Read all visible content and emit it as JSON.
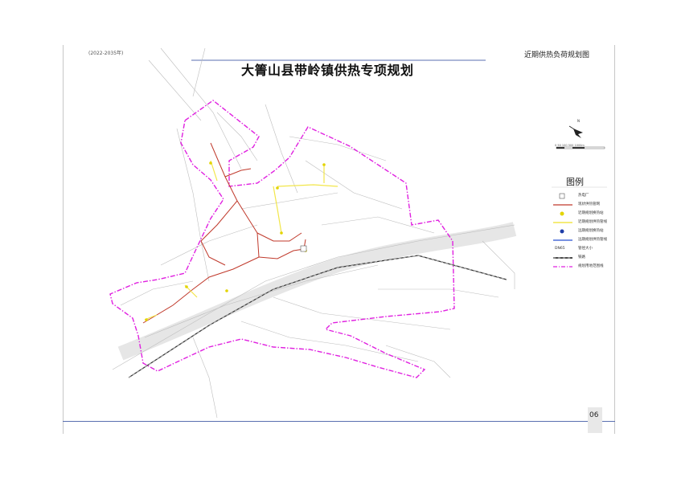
{
  "header": {
    "period": "(2022-2035年)",
    "sheet_title": "近期供热负荷规划图",
    "plan_title": "大箐山县带岭镇供热专项规划"
  },
  "page_number": "06",
  "north_label": "N",
  "scale_bar": "0 50 100   500         1000m",
  "legend": {
    "title": "图例",
    "items": [
      {
        "label": "热电厂",
        "symbol": "plant",
        "color": "#555555"
      },
      {
        "label": "现状供热管网",
        "symbol": "line",
        "color": "#c0392b"
      },
      {
        "label": "近期规划换热站",
        "symbol": "dot",
        "color": "#e3d400"
      },
      {
        "label": "近期规划供热管线",
        "symbol": "line",
        "color": "#f2e64a"
      },
      {
        "label": "远期规划换热站",
        "symbol": "dot",
        "color": "#1f3ea8"
      },
      {
        "label": "远期规划供热管线",
        "symbol": "line",
        "color": "#2850d0"
      },
      {
        "label": "管径大小",
        "symbol": "text",
        "color": "#333333",
        "text": "DN65"
      },
      {
        "label": "铁路",
        "symbol": "rail",
        "color": "#111111"
      },
      {
        "label": "规划用地范围线",
        "symbol": "dashdot",
        "color": "#e020e0"
      }
    ]
  },
  "colors": {
    "boundary": "#e020e0",
    "existing_network": "#c0392b",
    "near_term_network": "#f2e64a",
    "frame_line": "#5a6fb0",
    "road": "#b9b9b9"
  }
}
